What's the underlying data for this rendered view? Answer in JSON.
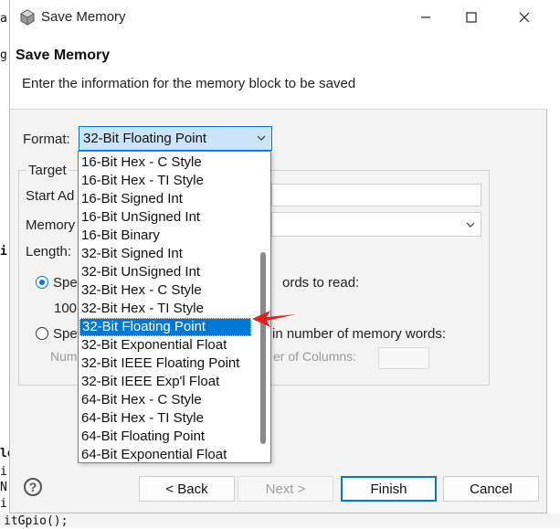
{
  "window": {
    "title": "Save Memory",
    "header_title": "Save Memory",
    "header_desc": "Enter the information for the memory block to be saved"
  },
  "format": {
    "label": "Format:",
    "selected": "32-Bit Floating Point",
    "options": [
      "16-Bit Hex - C Style",
      "16-Bit Hex - TI Style",
      "16-Bit Signed Int",
      "16-Bit UnSigned Int",
      "16-Bit Binary",
      "32-Bit Signed Int",
      "32-Bit UnSigned Int",
      "32-Bit Hex - C Style",
      "32-Bit Hex - TI Style",
      "32-Bit Floating Point",
      "32-Bit Exponential Float",
      "32-Bit IEEE Floating Point",
      "32-Bit IEEE Exp'l Float",
      "64-Bit Hex - C Style",
      "64-Bit Hex - TI Style",
      "64-Bit Floating Point",
      "64-Bit Exponential Float"
    ]
  },
  "target": {
    "group_label": "Target",
    "start_address_label": "Start Ad",
    "memory_label": "Memory",
    "length_label": "Length:",
    "spec_label_1": "Spe",
    "words_to_read": "ords to read:",
    "length_value": "100",
    "spec_label_2": "Spe",
    "in_number_words": "in number of memory words:",
    "num_label": "Num",
    "columns_label": "er of Columns:"
  },
  "buttons": {
    "help": "?",
    "back": "< Back",
    "next": "Next >",
    "finish": "Finish",
    "cancel": "Cancel"
  },
  "background_code": {
    "line_a": "a",
    "line_g": "g",
    "line_i": "i",
    "line_le": "le",
    "line_i2": "i",
    "line_n": "N",
    "line_i3": "i",
    "last_line": "itGpio();"
  },
  "colors": {
    "accent": "#0078d7",
    "selection_bg": "#cce4f7",
    "annotation_arrow": "#e02020"
  }
}
